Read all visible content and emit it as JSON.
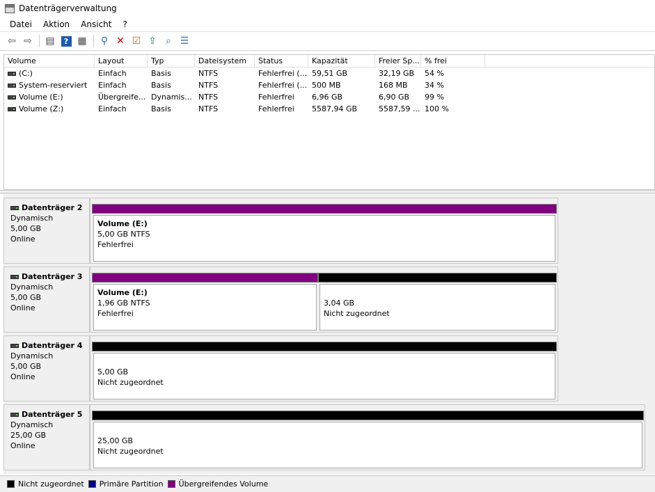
{
  "window": {
    "title": "Datenträgerverwaltung"
  },
  "menu": [
    "Datei",
    "Aktion",
    "Ansicht",
    "?"
  ],
  "toolbar": {
    "buttons": [
      {
        "icon": "back-arrow-icon",
        "glyph": "⇦",
        "color": "#555555"
      },
      {
        "icon": "forward-arrow-icon",
        "glyph": "⇨",
        "color": "#555555"
      },
      {
        "icon": "console-tree-icon",
        "glyph": "▤",
        "color": "#444444"
      },
      {
        "icon": "help-icon",
        "glyph": "?",
        "color": "#ffffff"
      },
      {
        "icon": "properties-icon",
        "glyph": "▦",
        "color": "#444444"
      },
      {
        "icon": "connect-icon",
        "glyph": "⚲",
        "color": "#3a6ea5"
      },
      {
        "icon": "delete-icon",
        "glyph": "✕",
        "color": "#cc0000"
      },
      {
        "icon": "checklist-icon",
        "glyph": "☑",
        "color": "#cc6600"
      },
      {
        "icon": "folder-up-icon",
        "glyph": "⇪",
        "color": "#2e8b57"
      },
      {
        "icon": "search-folder-icon",
        "glyph": "⌕",
        "color": "#3a6ea5"
      },
      {
        "icon": "settings-list-icon",
        "glyph": "☰",
        "color": "#3a6ea5"
      }
    ]
  },
  "list": {
    "columns": [
      "Volume",
      "Layout",
      "Typ",
      "Dateisystem",
      "Status",
      "Kapazität",
      "Freier Sp...",
      "% frei"
    ],
    "rows": [
      [
        "(C:)",
        "Einfach",
        "Basis",
        "NTFS",
        "Fehlerfrei (...",
        "59,51 GB",
        "32,19 GB",
        "54 %"
      ],
      [
        "System-reserviert",
        "Einfach",
        "Basis",
        "NTFS",
        "Fehlerfrei (...",
        "500 MB",
        "168 MB",
        "34 %"
      ],
      [
        "Volume (E:)",
        "Übergreife...",
        "Dynamis...",
        "NTFS",
        "Fehlerfrei",
        "6,96 GB",
        "6,90 GB",
        "99 %"
      ],
      [
        "Volume (Z:)",
        "Einfach",
        "Basis",
        "NTFS",
        "Fehlerfrei",
        "5587,94 GB",
        "5587,59 ...",
        "100 %"
      ]
    ]
  },
  "disks": [
    {
      "name": "Datenträger 2",
      "type": "Dynamisch",
      "size": "5,00 GB",
      "status": "Online",
      "partitions": [
        {
          "name": "Volume  (E:)",
          "size": "5,00 GB NTFS",
          "state": "Fehlerfrei",
          "kind": "spanned"
        }
      ]
    },
    {
      "name": "Datenträger 3",
      "type": "Dynamisch",
      "size": "5,00 GB",
      "status": "Online",
      "partitions": [
        {
          "name": "Volume  (E:)",
          "size": "1,96 GB NTFS",
          "state": "Fehlerfrei",
          "kind": "spanned"
        },
        {
          "name": "",
          "size": "3,04 GB",
          "state": "Nicht zugeordnet",
          "kind": "unallocated"
        }
      ]
    },
    {
      "name": "Datenträger 4",
      "type": "Dynamisch",
      "size": "5,00 GB",
      "status": "Online",
      "partitions": [
        {
          "name": "",
          "size": "5,00 GB",
          "state": "Nicht zugeordnet",
          "kind": "unallocated"
        }
      ]
    },
    {
      "name": "Datenträger 5",
      "type": "Dynamisch",
      "size": "25,00 GB",
      "status": "Online",
      "partitions": [
        {
          "name": "",
          "size": "25,00 GB",
          "state": "Nicht zugeordnet",
          "kind": "unallocated"
        }
      ]
    }
  ],
  "legend": [
    {
      "label": "Nicht zugeordnet",
      "color": "#000000"
    },
    {
      "label": "Primäre Partition",
      "color": "#00007f"
    },
    {
      "label": "Übergreifendes Volume",
      "color": "#800080"
    }
  ],
  "colors": {
    "spanned": "#800080",
    "unallocated": "#000000",
    "primary": "#00007f"
  }
}
